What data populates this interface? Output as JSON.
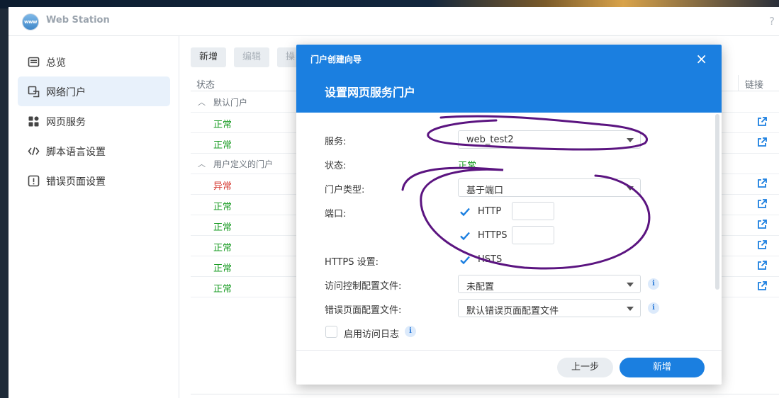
{
  "app": {
    "title": "Web Station",
    "logo_text": "www",
    "help_glyph": "?"
  },
  "sidebar": {
    "items": [
      {
        "label": "总览",
        "icon": "overview-icon"
      },
      {
        "label": "网络门户",
        "icon": "portal-icon",
        "active": true
      },
      {
        "label": "网页服务",
        "icon": "web-service-icon"
      },
      {
        "label": "脚本语言设置",
        "icon": "code-icon"
      },
      {
        "label": "错误页面设置",
        "icon": "error-page-icon"
      }
    ]
  },
  "toolbar": {
    "add_label": "新增",
    "edit_label": "编辑",
    "op_label": "操"
  },
  "table": {
    "headers": {
      "status": "状态",
      "link": "链接"
    },
    "groups": [
      {
        "label": "默认门户",
        "rows": [
          "正常",
          "正常"
        ]
      },
      {
        "label": "用户定义的门户",
        "rows": [
          "异常",
          "正常",
          "正常",
          "正常",
          "正常",
          "正常"
        ]
      }
    ]
  },
  "dialog": {
    "wizard_title": "门户创建向导",
    "close_glyph": "×",
    "step_title": "设置网页服务门户",
    "fields": {
      "service": {
        "label": "服务:",
        "value": "web_test2"
      },
      "status": {
        "label": "状态:",
        "value": "正常"
      },
      "portal_type": {
        "label": "门户类型:",
        "value": "基于端口"
      },
      "port": {
        "label": "端口:",
        "http_label": "HTTP",
        "https_label": "HTTPS",
        "http_value": "",
        "https_value": ""
      },
      "https_settings": {
        "label": "HTTPS 设置:",
        "hsts_label": "HSTS"
      },
      "access_profile": {
        "label": "访问控制配置文件:",
        "value": "未配置"
      },
      "error_profile": {
        "label": "错误页面配置文件:",
        "value": "默认错误页面配置文件"
      },
      "access_log": {
        "label": "启用访问日志"
      }
    },
    "info_glyph": "i",
    "buttons": {
      "prev": "上一步",
      "create": "新增"
    }
  },
  "colors": {
    "accent": "#1b7fe0",
    "status_ok": "#1a9c24",
    "status_bad": "#d63b33",
    "annotation": "#5b1480"
  }
}
